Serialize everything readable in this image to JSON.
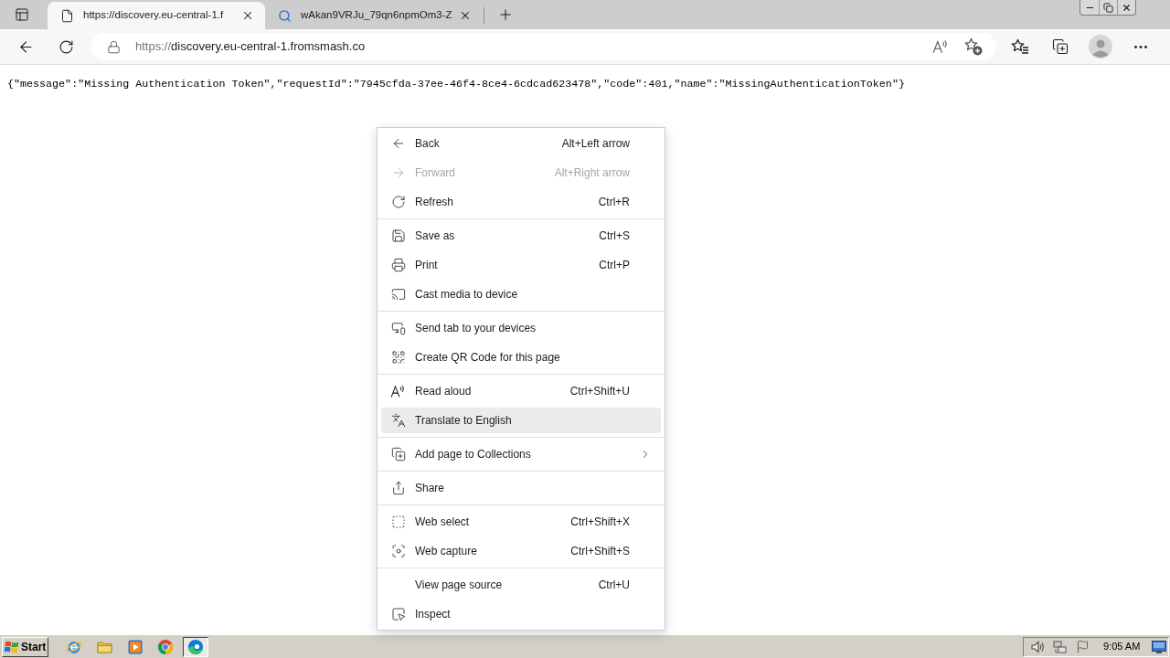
{
  "tabs": [
    {
      "title": "https://discovery.eu-central-1.f",
      "selected": true
    },
    {
      "title": "wAkan9VRJu_79qn6npmOm3-Z",
      "selected": false
    }
  ],
  "address_bar": {
    "scheme": "https://",
    "host": "discovery.eu-central-1.fromsmash.co"
  },
  "page": {
    "text": "{\"message\":\"Missing Authentication Token\",\"requestId\":\"7945cfda-37ee-46f4-8ce4-6cdcad623478\",\"code\":401,\"name\":\"MissingAuthenticationToken\"}"
  },
  "context_menu": {
    "groups": [
      {
        "items": [
          {
            "label": "Back",
            "shortcut": "Alt+Left arrow",
            "disabled": false,
            "highlighted": false,
            "submenu": false
          },
          {
            "label": "Forward",
            "shortcut": "Alt+Right arrow",
            "disabled": true,
            "highlighted": false,
            "submenu": false
          },
          {
            "label": "Refresh",
            "shortcut": "Ctrl+R",
            "disabled": false,
            "highlighted": false,
            "submenu": false
          }
        ]
      },
      {
        "items": [
          {
            "label": "Save as",
            "shortcut": "Ctrl+S",
            "disabled": false,
            "highlighted": false,
            "submenu": false
          },
          {
            "label": "Print",
            "shortcut": "Ctrl+P",
            "disabled": false,
            "highlighted": false,
            "submenu": false
          },
          {
            "label": "Cast media to device",
            "disabled": false,
            "highlighted": false,
            "submenu": false
          }
        ]
      },
      {
        "items": [
          {
            "label": "Send tab to your devices",
            "disabled": false,
            "highlighted": false,
            "submenu": false
          },
          {
            "label": "Create QR Code for this page",
            "disabled": false,
            "highlighted": false,
            "submenu": false
          }
        ]
      },
      {
        "items": [
          {
            "label": "Read aloud",
            "shortcut": "Ctrl+Shift+U",
            "disabled": false,
            "highlighted": false,
            "submenu": false
          },
          {
            "label": "Translate to English",
            "disabled": false,
            "highlighted": true,
            "submenu": false
          }
        ]
      },
      {
        "items": [
          {
            "label": "Add page to Collections",
            "disabled": false,
            "highlighted": false,
            "submenu": true
          }
        ]
      },
      {
        "items": [
          {
            "label": "Share",
            "disabled": false,
            "highlighted": false,
            "submenu": false
          }
        ]
      },
      {
        "items": [
          {
            "label": "Web select",
            "shortcut": "Ctrl+Shift+X",
            "disabled": false,
            "highlighted": false,
            "submenu": false
          },
          {
            "label": "Web capture",
            "shortcut": "Ctrl+Shift+S",
            "disabled": false,
            "highlighted": false,
            "submenu": false
          }
        ]
      },
      {
        "items": [
          {
            "label": "View page source",
            "shortcut": "Ctrl+U",
            "disabled": false,
            "highlighted": false,
            "submenu": false
          },
          {
            "label": "Inspect",
            "disabled": false,
            "highlighted": false,
            "submenu": false
          }
        ]
      }
    ]
  },
  "taskbar": {
    "start": "Start",
    "tasks": [
      {
        "selected": true
      }
    ],
    "clock": "9:05 AM"
  }
}
